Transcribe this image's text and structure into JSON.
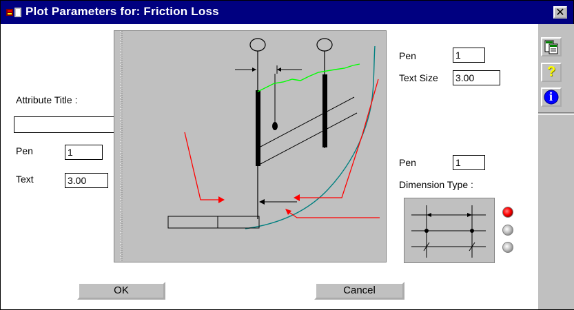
{
  "window": {
    "title": "Plot Parameters for:  Friction Loss",
    "close_glyph": "✕"
  },
  "toolbar": {
    "buttons": [
      {
        "name": "copy-icon",
        "glyph": ""
      },
      {
        "name": "help-icon",
        "glyph": "?"
      },
      {
        "name": "info-icon",
        "glyph": "i"
      }
    ]
  },
  "left": {
    "attribute_title_label": "Attribute Title :",
    "attribute_title_value": "",
    "pen_label": "Pen",
    "pen_value": "1",
    "text_label": "Text",
    "text_value": "3.00"
  },
  "right_top": {
    "pen_label": "Pen",
    "pen_value": "1",
    "text_size_label": "Text Size",
    "text_size_value": "3.00"
  },
  "right_bottom": {
    "pen_label": "Pen",
    "pen_value": "1",
    "dimension_type_label": "Dimension Type :",
    "options": [
      {
        "state": "selected"
      },
      {
        "state": "unselected"
      },
      {
        "state": "unselected"
      }
    ]
  },
  "buttons": {
    "ok": "OK",
    "cancel": "Cancel"
  },
  "colors": {
    "title_bar": "#000080",
    "accent_red": "#ff0000",
    "curve_green": "#00ff00",
    "curve_teal": "#008080"
  }
}
